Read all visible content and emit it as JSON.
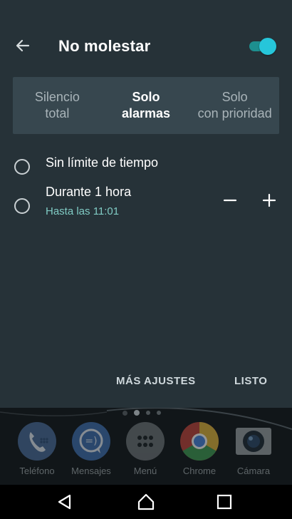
{
  "header": {
    "title": "No molestar",
    "toggle_on": true,
    "accent_color": "#26c6da"
  },
  "modes": [
    {
      "line1": "Silencio",
      "line2": "total",
      "selected": false
    },
    {
      "line1": "Solo",
      "line2": "alarmas",
      "selected": true
    },
    {
      "line1": "Solo",
      "line2": "con prioridad",
      "selected": false
    }
  ],
  "duration": {
    "option_indefinite": "Sin límite de tiempo",
    "option_timed": "Durante 1 hora",
    "timed_until": "Hasta las 11:01",
    "selected": "none"
  },
  "actions": {
    "more_settings": "MÁS AJUSTES",
    "done": "LISTO"
  },
  "home": {
    "page_count": 4,
    "current_page": 1,
    "dock": [
      {
        "label": "Teléfono",
        "icon": "phone-icon"
      },
      {
        "label": "Mensajes",
        "icon": "messages-icon"
      },
      {
        "label": "Menú",
        "icon": "app-drawer-icon"
      },
      {
        "label": "Chrome",
        "icon": "chrome-icon"
      },
      {
        "label": "Cámara",
        "icon": "camera-icon"
      }
    ]
  },
  "colors": {
    "panel": "#263238",
    "segment_bg": "#37474f",
    "subtext_teal": "#80cbc4"
  }
}
